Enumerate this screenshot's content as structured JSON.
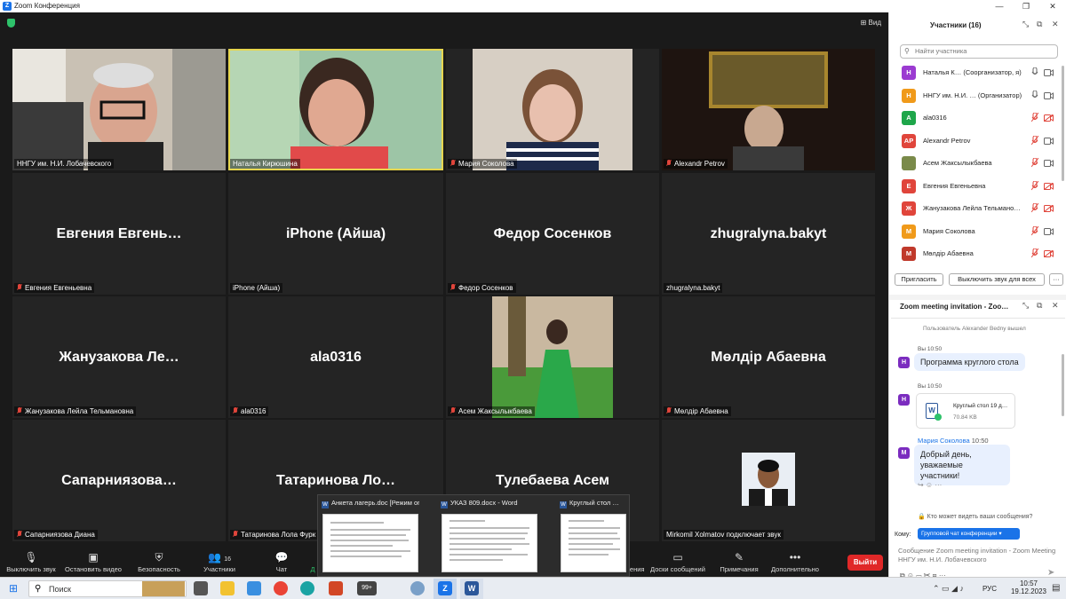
{
  "window": {
    "title": "Zoom Конференция",
    "view_label": "Вид"
  },
  "tiles": [
    {
      "name": "ННГУ им. Н.И. Лобачевского",
      "big": "",
      "muted": false,
      "video": true
    },
    {
      "name": "Наталья Кирюшина",
      "big": "",
      "muted": false,
      "video": true,
      "active": true
    },
    {
      "name": "Мария Соколова",
      "big": "",
      "muted": true,
      "video": true
    },
    {
      "name": "Alexandr Petrov",
      "big": "",
      "muted": true,
      "video": true
    },
    {
      "name": "Евгения Евгеньевна",
      "big": "Евгения  Евгень…",
      "muted": true
    },
    {
      "name": "iPhone (Айша)",
      "big": "iPhone (Айша)",
      "muted": false
    },
    {
      "name": "Федор Сосенков",
      "big": "Федор Сосенков",
      "muted": true
    },
    {
      "name": "zhugralyna.bakyt",
      "big": "zhugralyna.bakyt",
      "muted": false
    },
    {
      "name": "Жанузакова Лейла Тельмановна",
      "big": "Жанузакова  Ле…",
      "muted": true
    },
    {
      "name": "ala0316",
      "big": "ala0316",
      "muted": true
    },
    {
      "name": "Асем Жаксылыкбаева",
      "big": "",
      "muted": true,
      "video": true
    },
    {
      "name": "Мөлдір Абаевна",
      "big": "Мөлдір Абаевна",
      "muted": true
    },
    {
      "name": "Сапарниязова Диана",
      "big": "Сапарниязова…",
      "muted": true
    },
    {
      "name": "Татаринова Лола Фурк",
      "big": "Татаринова  Ло…",
      "muted": true
    },
    {
      "name": "",
      "big": "Тулебаева Асем",
      "muted": false
    },
    {
      "name": "Mirkomil Xolmatov подключает звук",
      "big": "",
      "muted": false,
      "video": true
    }
  ],
  "toolbar": {
    "mute": "Выключить звук",
    "video": "Остановить видео",
    "security": "Безопасность",
    "participants": "Участники",
    "participants_count": "16",
    "chat": "Чат",
    "share_partial": "Д",
    "reactions_partial": "дения",
    "whiteboards": "Доски сообщений",
    "notes": "Примечания",
    "more": "Дополнительно",
    "leave": "Выйти"
  },
  "share_thumbs": [
    {
      "title": "Анкета лагерь.doc [Режим ог…"
    },
    {
      "title": "УКАЗ 809.docx - Word"
    },
    {
      "title": "Круглый стол …"
    }
  ],
  "participants_panel": {
    "title": "Участники (16)",
    "search_placeholder": "Найти участника",
    "list": [
      {
        "initials": "Н",
        "name": "Наталья К… (Соорганизатор, я)",
        "color": "#9b3bd1",
        "muted": false,
        "cam_off": false
      },
      {
        "initials": "Н",
        "name": "ННГУ им. Н.И. … (Организатор)",
        "color": "#f09a1a",
        "muted": false,
        "cam_off": false
      },
      {
        "initials": "A",
        "name": "ala0316",
        "color": "#1ea64a",
        "muted": true,
        "cam_off": true
      },
      {
        "initials": "AP",
        "name": "Alexandr Petrov",
        "color": "#e0453b",
        "muted": true,
        "cam_off": false
      },
      {
        "initials": "",
        "name": "Асем Жаксылыкбаева",
        "color": "#7a8a4a",
        "muted": true,
        "cam_off": false
      },
      {
        "initials": "Е",
        "name": "Евгения Евгеньевна",
        "color": "#e0453b",
        "muted": true,
        "cam_off": true
      },
      {
        "initials": "Ж",
        "name": "Жанузакова Лейла Тельмано…",
        "color": "#e0453b",
        "muted": true,
        "cam_off": true
      },
      {
        "initials": "М",
        "name": "Мария Соколова",
        "color": "#f09a1a",
        "muted": true,
        "cam_off": false
      },
      {
        "initials": "М",
        "name": "Мөлдір Абаевна",
        "color": "#c0392b",
        "muted": true,
        "cam_off": true
      }
    ],
    "invite": "Пригласить",
    "mute_all": "Выключить звук для всех",
    "more": "···"
  },
  "chat_panel": {
    "title": "Zoom meeting invitation - Zoo…",
    "system_msg": "Пользователь Alexander Bedny вышел",
    "messages": [
      {
        "sender": "Вы",
        "time": "10:50",
        "text": "Программа круглого стола"
      },
      {
        "sender": "Вы",
        "time": "10:50",
        "file_name": "Круглый стол 19 д…",
        "file_size": "70.84 KB"
      },
      {
        "sender": "Мария Соколова",
        "time": "10:50",
        "text": "Добрый день, уважаемые участники!"
      }
    ],
    "who_can_see": "Кто может видеть ваши сообщения?",
    "to_label": "Кому:",
    "to_value": "Групповой чат конференции",
    "input_placeholder": "Сообщение Zoom meeting invitation - Zoom Meeting ННГУ им. Н.И. Лобачевского"
  },
  "taskbar": {
    "search": "Поиск",
    "badge": "99+",
    "lang": "РУС",
    "time": "10:57",
    "date": "19.12.2023"
  }
}
